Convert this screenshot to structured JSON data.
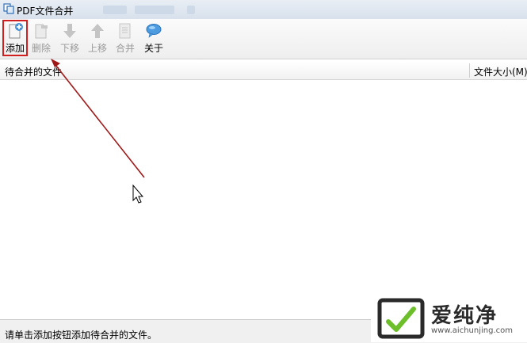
{
  "window": {
    "title": "PDF文件合并"
  },
  "toolbar": {
    "add_label": "添加",
    "delete_label": "删除",
    "down_label": "下移",
    "up_label": "上移",
    "merge_label": "合并",
    "about_label": "关于"
  },
  "list": {
    "col_name": "待合并的文件",
    "col_size": "文件大小(M)"
  },
  "status": {
    "text": "请单击添加按钮添加待合并的文件。"
  },
  "watermark": {
    "brand": "爱纯净",
    "url": "www.aichunjing.com"
  },
  "colors": {
    "highlight": "#d11f1f",
    "arrow": "#a01818",
    "accent": "#3a8fd8"
  }
}
